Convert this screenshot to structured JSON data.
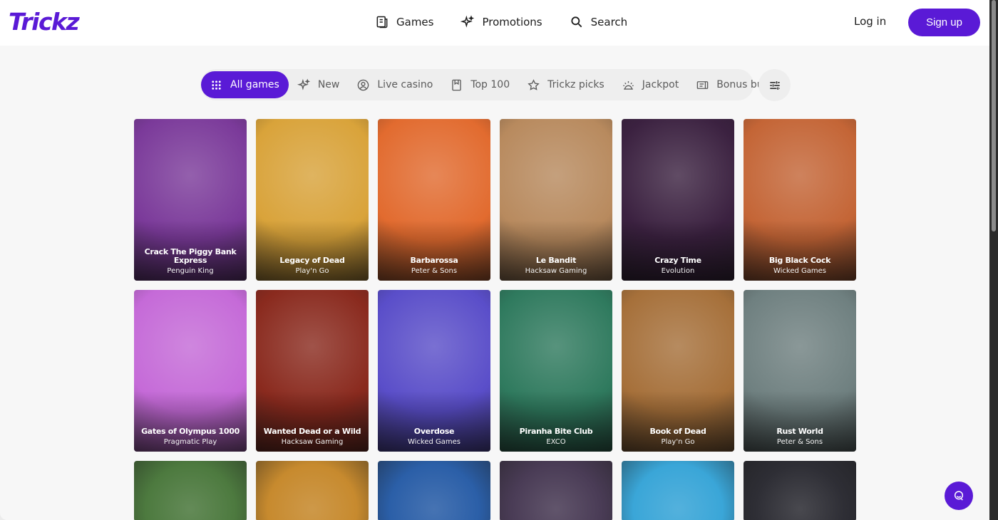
{
  "header": {
    "logo": "Trickz",
    "nav": [
      {
        "label": "Games",
        "icon": "games-icon"
      },
      {
        "label": "Promotions",
        "icon": "sparkle-icon"
      },
      {
        "label": "Search",
        "icon": "search-icon"
      }
    ],
    "login_label": "Log in",
    "signup_label": "Sign up"
  },
  "filters": [
    {
      "label": "All games",
      "icon": "grid-icon",
      "active": true
    },
    {
      "label": "New",
      "icon": "sparkle-icon",
      "active": false
    },
    {
      "label": "Live casino",
      "icon": "live-icon",
      "active": false
    },
    {
      "label": "Top 100",
      "icon": "bookmark-icon",
      "active": false
    },
    {
      "label": "Trickz picks",
      "icon": "star-icon",
      "active": false
    },
    {
      "label": "Jackpot",
      "icon": "jackpot-icon",
      "active": false
    },
    {
      "label": "Bonus buy",
      "icon": "ticket-icon",
      "active": false
    }
  ],
  "games": [
    {
      "title": "Crack The Piggy Bank Express",
      "provider": "Penguin King",
      "color": "#7b3a9a"
    },
    {
      "title": "Legacy of Dead",
      "provider": "Play'n Go",
      "color": "#d9a33a"
    },
    {
      "title": "Barbarossa",
      "provider": "Peter & Sons",
      "color": "#e26b2f"
    },
    {
      "title": "Le Bandit",
      "provider": "Hacksaw Gaming",
      "color": "#b88a5e"
    },
    {
      "title": "Crazy Time",
      "provider": "Evolution",
      "color": "#3b2140"
    },
    {
      "title": "Big Black Cock",
      "provider": "Wicked Games",
      "color": "#c46536"
    },
    {
      "title": "Gates of Olympus 1000",
      "provider": "Pragmatic Play",
      "color": "#c56ad8"
    },
    {
      "title": "Wanted Dead or a Wild",
      "provider": "Hacksaw Gaming",
      "color": "#8a2a1e"
    },
    {
      "title": "Overdose",
      "provider": "Wicked Games",
      "color": "#5a4ec9"
    },
    {
      "title": "Piranha Bite Club",
      "provider": "EXCO",
      "color": "#2f7a5e"
    },
    {
      "title": "Book of Dead",
      "provider": "Play'n Go",
      "color": "#a6703a"
    },
    {
      "title": "Rust World",
      "provider": "Peter & Sons",
      "color": "#6f8080"
    }
  ],
  "partial_row_colors": [
    "#4d7a3f",
    "#c78a2e",
    "#2b5fa8",
    "#4a3c56",
    "#3aa6d8",
    "#2e2e35"
  ]
}
